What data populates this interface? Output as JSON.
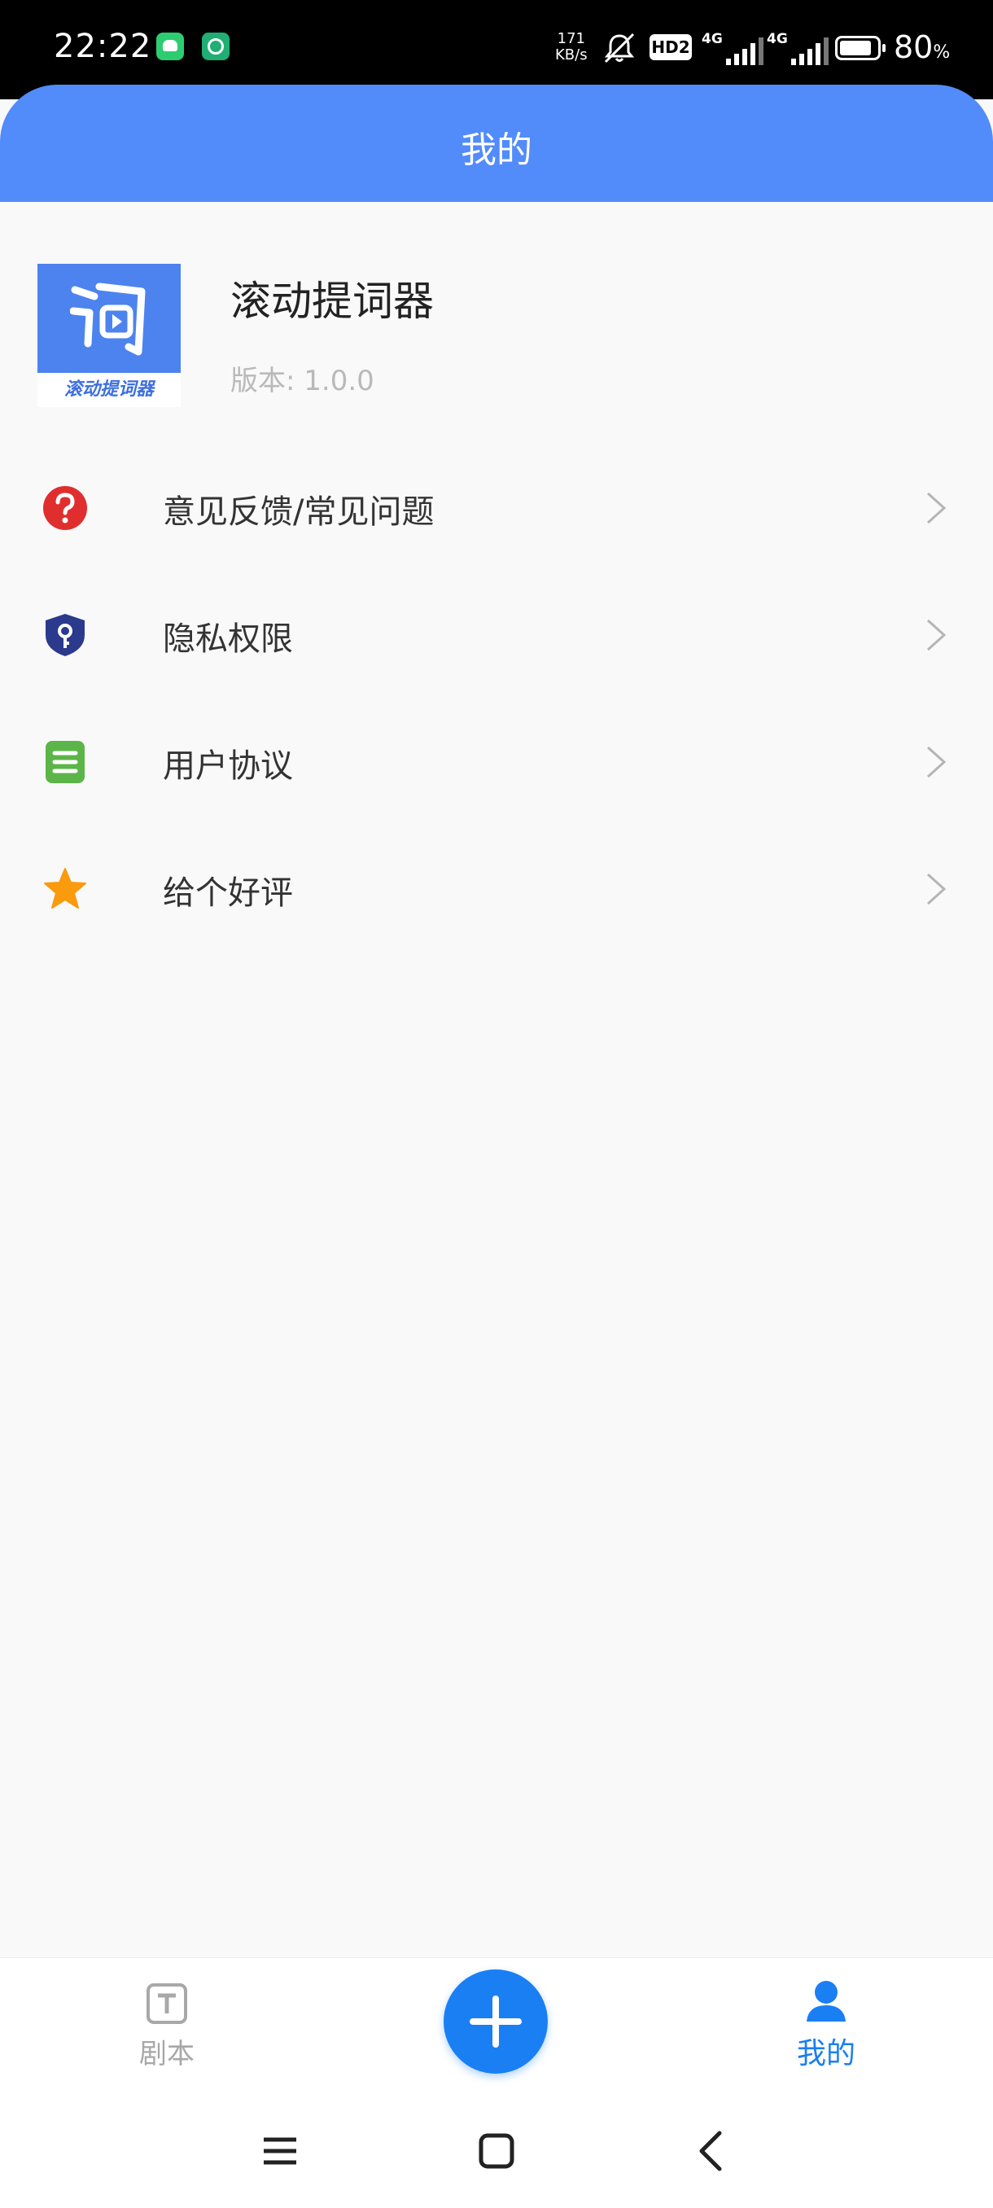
{
  "status_bar": {
    "time": "22:22",
    "speed_value": "171",
    "speed_unit": "KB/s",
    "hd_badge": "HD2",
    "network1": "4G",
    "network2": "4G",
    "battery_percent": "80",
    "battery_unit": "%"
  },
  "header": {
    "title": "我的"
  },
  "app": {
    "name": "滚动提词器",
    "version": "版本: 1.0.0",
    "logo_text": "滚动提词器"
  },
  "menu": {
    "items": [
      {
        "label": "意见反馈/常见问题",
        "icon": "question-icon",
        "color": "#e02e2e"
      },
      {
        "label": "隐私权限",
        "icon": "shield-key-icon",
        "color": "#2b3a8c"
      },
      {
        "label": "用户协议",
        "icon": "document-list-icon",
        "color": "#5cb548"
      },
      {
        "label": "给个好评",
        "icon": "star-icon",
        "color": "#f99b0c"
      }
    ]
  },
  "bottom_nav": {
    "script_label": "剧本",
    "me_label": "我的",
    "active_color": "#1a7ff3",
    "inactive_color": "#a8a8a8"
  },
  "colors": {
    "header": "#528bfa",
    "background": "#f9f9f9",
    "accent": "#1a7ff3"
  }
}
